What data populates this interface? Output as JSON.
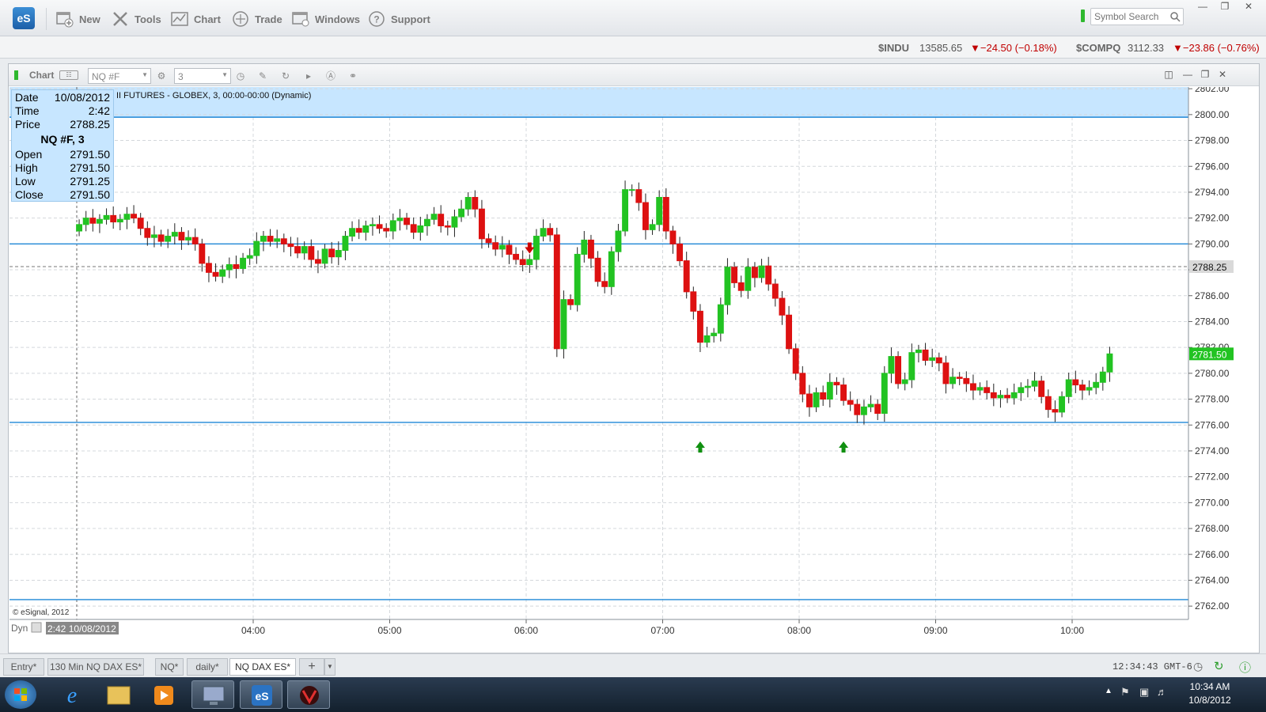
{
  "app": {
    "logo": "eS"
  },
  "toolbar": {
    "items": [
      {
        "label": "New",
        "icon": "new-window-icon"
      },
      {
        "label": "Tools",
        "icon": "tools-icon"
      },
      {
        "label": "Chart",
        "icon": "chart-icon"
      },
      {
        "label": "Trade",
        "icon": "trade-icon"
      },
      {
        "label": "Windows",
        "icon": "windows-icon"
      },
      {
        "label": "Support",
        "icon": "help-icon"
      }
    ],
    "search_placeholder": "Symbol Search"
  },
  "ticker": [
    {
      "symbol": "$INDU",
      "price": "13585.65",
      "change": "▼−24.50 (−0.18%)"
    },
    {
      "symbol": "$COMPQ",
      "price": "3112.33",
      "change": "▼−23.86 (−0.76%)"
    }
  ],
  "chart_window": {
    "title": "Chart",
    "symbol": "NQ #F",
    "interval": "3",
    "header_text": "II FUTURES - GLOBEX, 3, 00:00-00:00 (Dynamic)",
    "copyright": "© eSignal, 2012",
    "cursor_label": "2:42 10/08/2012",
    "dyn_label": "Dyn",
    "price_marker_gray": "2788.25",
    "price_marker_last": "2781.50"
  },
  "info_box": {
    "date_label": "Date",
    "date": "10/08/2012",
    "time_label": "Time",
    "time": "2:42",
    "price_label": "Price",
    "price": "2788.25",
    "series_title": "NQ #F, 3",
    "open_label": "Open",
    "open": "2791.50",
    "high_label": "High",
    "high": "2791.50",
    "low_label": "Low",
    "low": "2791.25",
    "close_label": "Close",
    "close": "2791.50"
  },
  "chart_data": {
    "type": "candlestick",
    "title": "NQ #F, 3",
    "ylim": [
      2761,
      2802
    ],
    "y_ticks": [
      "2762.00",
      "2764.00",
      "2766.00",
      "2768.00",
      "2770.00",
      "2772.00",
      "2774.00",
      "2776.00",
      "2778.00",
      "2780.00",
      "2782.00",
      "2784.00",
      "2786.00",
      "2788.00",
      "2790.00",
      "2792.00",
      "2794.00",
      "2796.00",
      "2798.00",
      "2800.00",
      "2802.00"
    ],
    "x_ticks": [
      {
        "label": "04:00",
        "minutes": 240
      },
      {
        "label": "05:00",
        "minutes": 300
      },
      {
        "label": "06:00",
        "minutes": 360
      },
      {
        "label": "07:00",
        "minutes": 420
      },
      {
        "label": "08:00",
        "minutes": 480
      },
      {
        "label": "09:00",
        "minutes": 540
      },
      {
        "label": "10:00",
        "minutes": 600
      }
    ],
    "x_start_minutes": 162,
    "bar_minutes": 3,
    "horizontal_lines": [
      2799.8,
      2790.0,
      2776.2,
      2762.5
    ],
    "dashed_line": 2788.25,
    "arrows": [
      {
        "dir": "down",
        "bar": 66,
        "price": 2789.5,
        "color": "#cc0000"
      },
      {
        "dir": "up",
        "bar": 91,
        "price": 2774.3,
        "color": "#109010"
      },
      {
        "dir": "up",
        "bar": 112,
        "price": 2774.3,
        "color": "#109010"
      }
    ],
    "ohlc_start": 2791,
    "closes": [
      2791.5,
      2792.0,
      2791.6,
      2791.9,
      2792.2,
      2791.7,
      2791.9,
      2792.3,
      2792.0,
      2791.2,
      2790.5,
      2790.7,
      2790.2,
      2790.6,
      2790.9,
      2790.3,
      2790.5,
      2790.0,
      2788.5,
      2787.8,
      2787.5,
      2788.0,
      2788.4,
      2788.1,
      2788.9,
      2789.1,
      2790.2,
      2790.6,
      2790.2,
      2790.4,
      2790.0,
      2789.8,
      2789.3,
      2789.8,
      2788.8,
      2788.5,
      2789.6,
      2789.0,
      2789.5,
      2790.6,
      2791.2,
      2790.9,
      2791.4,
      2791.5,
      2791.2,
      2791.0,
      2791.8,
      2792.0,
      2791.5,
      2790.9,
      2791.4,
      2791.9,
      2792.3,
      2791.4,
      2791.3,
      2792.1,
      2792.7,
      2793.6,
      2792.7,
      2790.4,
      2790.1,
      2789.6,
      2789.9,
      2789.2,
      2788.8,
      2788.4,
      2788.8,
      2790.6,
      2791.2,
      2790.7,
      2781.9,
      2785.7,
      2785.3,
      2789.2,
      2790.3,
      2788.9,
      2787.1,
      2786.7,
      2789.4,
      2791.0,
      2794.2,
      2794.2,
      2793.2,
      2791.1,
      2791.5,
      2793.6,
      2791.0,
      2790.0,
      2788.7,
      2786.3,
      2784.8,
      2782.4,
      2782.9,
      2783.1,
      2785.3,
      2788.2,
      2787.0,
      2786.4,
      2788.2,
      2787.4,
      2788.3,
      2786.9,
      2785.8,
      2784.5,
      2781.9,
      2780.0,
      2778.4,
      2777.4,
      2778.5,
      2778.0,
      2779.3,
      2779.1,
      2777.9,
      2777.6,
      2776.8,
      2777.4,
      2777.6,
      2776.9,
      2780.0,
      2781.3,
      2779.2,
      2779.5,
      2781.6,
      2781.8,
      2781.0,
      2781.2,
      2780.8,
      2779.2,
      2779.7,
      2779.6,
      2779.2,
      2778.7,
      2778.9,
      2778.5,
      2778.1,
      2778.3,
      2778.1,
      2778.5,
      2778.9,
      2779.0,
      2779.4,
      2778.2,
      2777.2,
      2777.0,
      2778.2,
      2779.5,
      2779.1,
      2778.7,
      2778.9,
      2779.3,
      2780.1,
      2781.5
    ]
  }
}
